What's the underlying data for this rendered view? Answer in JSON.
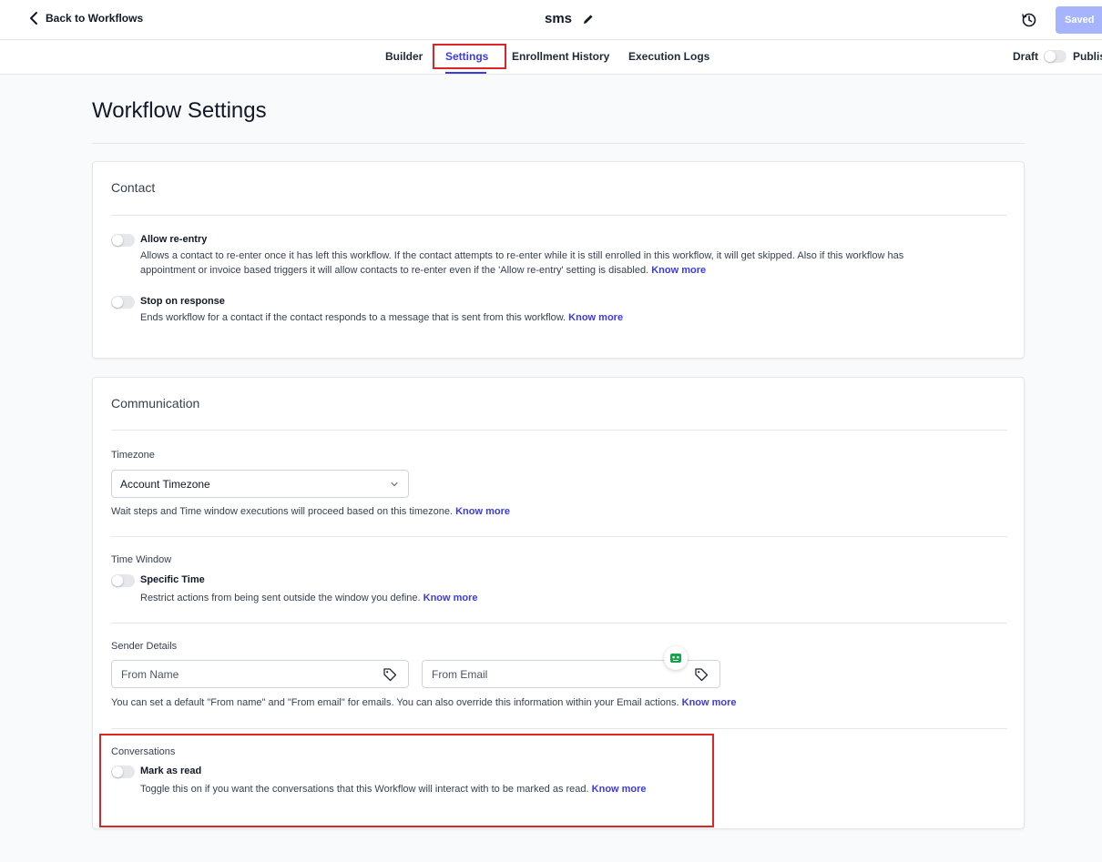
{
  "header": {
    "back_label": "Back to Workflows",
    "workflow_name": "sms",
    "saved_label": "Saved"
  },
  "tabs": [
    {
      "label": "Builder"
    },
    {
      "label": "Settings",
      "active": true
    },
    {
      "label": "Enrollment History"
    },
    {
      "label": "Execution Logs"
    }
  ],
  "status": {
    "draft_label": "Draft",
    "publish_label": "Publish",
    "published": false
  },
  "page_title": "Workflow Settings",
  "contact": {
    "title": "Contact",
    "allow_reentry": {
      "label": "Allow re-entry",
      "enabled": false,
      "desc_line1": "Allows a contact to re-enter once it has left this workflow. If the contact attempts to re-enter while it is still enrolled in this workflow, it will get skipped. Also if this workflow has",
      "desc_line2": "appointment or invoice based triggers it will allow contacts to re-enter even if the 'Allow re-entry' setting is disabled.",
      "link": "Know more"
    },
    "stop_on_response": {
      "label": "Stop on response",
      "enabled": false,
      "desc": "Ends workflow for a contact if the contact responds to a message that is sent from this workflow.",
      "link": "Know more"
    }
  },
  "communication": {
    "title": "Communication",
    "timezone": {
      "label": "Timezone",
      "value": "Account Timezone",
      "desc": "Wait steps and Time window executions will proceed based on this timezone.",
      "link": "Know more"
    },
    "time_window": {
      "label": "Time Window",
      "toggle_label": "Specific Time",
      "enabled": false,
      "desc": "Restrict actions from being sent outside the window you define.",
      "link": "Know more"
    },
    "sender_details": {
      "label": "Sender Details",
      "from_name_placeholder": "From Name",
      "from_email_placeholder": "From Email",
      "desc": "You can set a default \"From name\" and \"From email\" for emails. You can also override this information within your Email actions.",
      "link": "Know more"
    },
    "conversations": {
      "label": "Conversations",
      "toggle_label": "Mark as read",
      "enabled": false,
      "desc": "Toggle this on if you want the conversations that this Workflow will interact with to be marked as read.",
      "link": "Know more"
    }
  },
  "colors": {
    "accent": "#3b3be0",
    "saved_button": "#a5b4fc",
    "highlight": "#dc2626"
  }
}
